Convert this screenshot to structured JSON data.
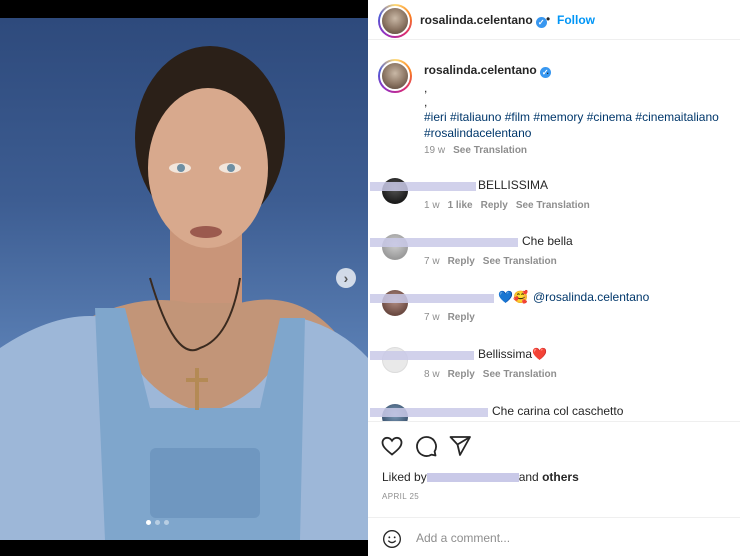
{
  "post": {
    "username": "rosalinda.celentano",
    "follow_label": "Follow",
    "header_separator": "•"
  },
  "caption": {
    "username": "rosalinda.celentano",
    "text": ".",
    "line2": ",",
    "line3": ",",
    "hashtags": "#ieri #italiauno #film #memory #cinema #cinemaitaliano #rosalindacelentano",
    "time": "19 w",
    "see_translation": "See Translation"
  },
  "comments": [
    {
      "text": "BELLISSIMA",
      "time": "1 w",
      "likes": "1 like",
      "reply": "Reply",
      "see_translation": "See Translation"
    },
    {
      "text": "Che bella",
      "time": "7 w",
      "reply": "Reply",
      "see_translation": "See Translation"
    },
    {
      "text_emoji": "💙🥰",
      "mention": "@rosalinda.celentano",
      "time": "7 w",
      "reply": "Reply"
    },
    {
      "text": "Bellissima❤️",
      "time": "8 w",
      "reply": "Reply",
      "see_translation": "See Translation"
    },
    {
      "text": "Che carina col caschetto"
    }
  ],
  "actions": {
    "liked_by_prefix": "Liked by",
    "liked_by_and": "and",
    "liked_by_others": "others",
    "date": "APRIL 25"
  },
  "composer": {
    "placeholder": "Add a comment..."
  },
  "icons": {
    "next": "chevron-right-icon",
    "like": "heart-icon",
    "comment": "comment-bubble-icon",
    "share": "paper-plane-icon",
    "emoji": "smiley-icon",
    "verified": "verified-badge-icon"
  },
  "colors": {
    "link": "#00376b",
    "follow": "#0095f6",
    "muted": "#8e8e8e",
    "verified": "#3897f0"
  }
}
